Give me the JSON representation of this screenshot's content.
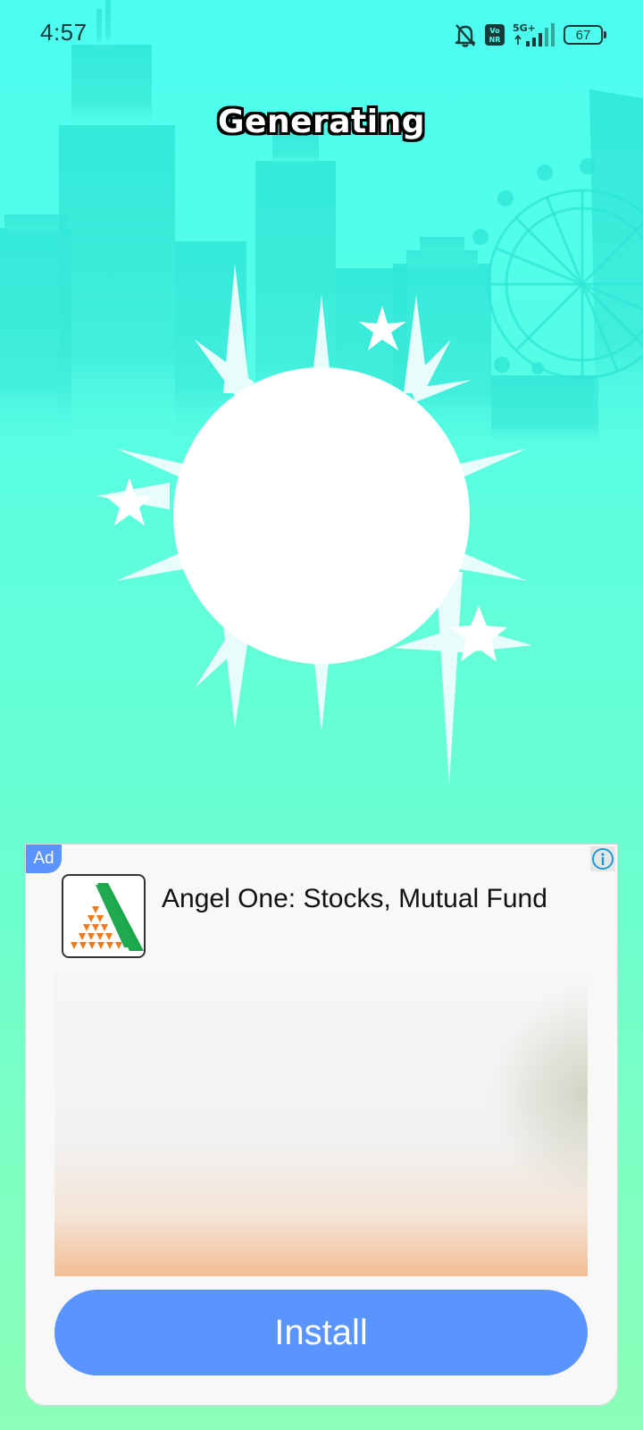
{
  "status_bar": {
    "time": "4:57",
    "network": "5G+",
    "volte_label": "Vo NR",
    "battery": "67",
    "icons": [
      "silent-bell-icon",
      "volte-icon",
      "signal-icon",
      "battery-icon"
    ]
  },
  "screen": {
    "title": "Generating"
  },
  "ad": {
    "badge": "Ad",
    "app_name": "Angel One: Stocks, Mutual Fund",
    "install_label": "Install",
    "icons": [
      "info-icon",
      "angel-one-logo"
    ]
  },
  "colors": {
    "background_top": "#4dfff0",
    "background_bottom": "#8cffb8",
    "accent_blue": "#5a95ff",
    "sun": "#ffffff"
  }
}
